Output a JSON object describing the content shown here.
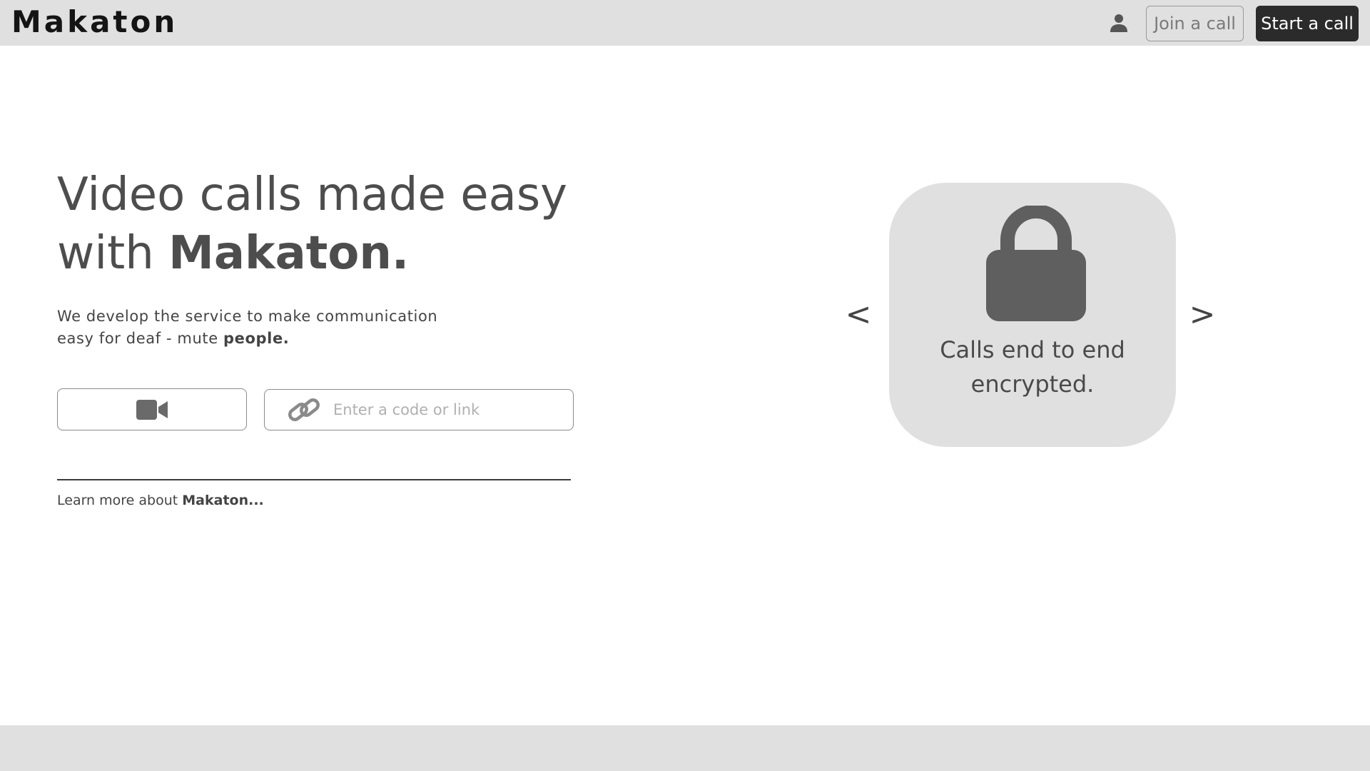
{
  "header": {
    "brand": "Makaton",
    "join_label": "Join a call",
    "start_label": "Start a call"
  },
  "hero": {
    "title_line1": "Video calls made easy",
    "title_line2_prefix": "with ",
    "title_line2_bold": "Makaton.",
    "subtitle_line1": "We develop the service to make communication",
    "subtitle_line2_prefix": "easy for deaf - mute ",
    "subtitle_line2_bold": "people."
  },
  "actions": {
    "code_placeholder": "Enter a code or link",
    "code_value": ""
  },
  "learn_more": {
    "prefix": "Learn more about ",
    "bold": "Makaton..."
  },
  "carousel": {
    "prev_label": "<",
    "next_label": ">",
    "feature_line1": "Calls end to end",
    "feature_line2": "encrypted."
  },
  "icons": {
    "user": "user-icon",
    "video": "video-camera-icon",
    "link": "link-icon",
    "lock": "lock-icon"
  },
  "colors": {
    "header_bg": "#e0e0e0",
    "primary_button": "#2b2b2b",
    "card_bg": "#e0e0e0",
    "icon_gray": "#5f5f5f"
  }
}
